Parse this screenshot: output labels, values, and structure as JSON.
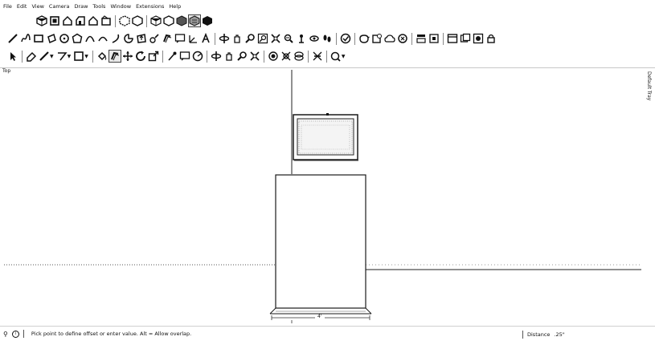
{
  "menu": {
    "items": [
      "File",
      "Edit",
      "View",
      "Camera",
      "Draw",
      "Tools",
      "Window",
      "Extensions",
      "Help"
    ]
  },
  "viewport": {
    "scene_label": "Top",
    "tray_label": "Default Tray",
    "dimension_label": "4'"
  },
  "status": {
    "message": "Pick point to define offset or enter value. Alt = Allow overlap.",
    "measure_label": "Distance",
    "measure_value": ".25\""
  },
  "colors": {
    "background": "#ffffff",
    "model_edge": "#1a1a1a",
    "axis_dotted": "#555555"
  }
}
